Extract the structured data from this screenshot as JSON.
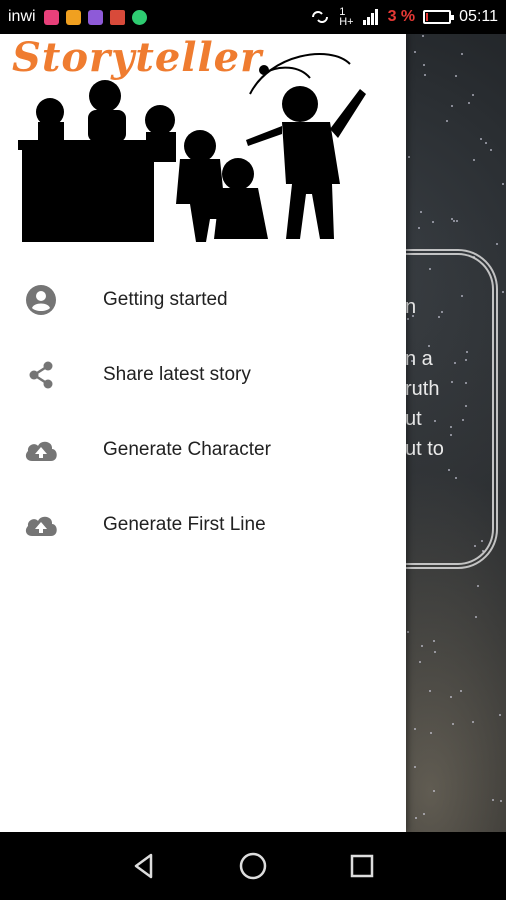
{
  "status_bar": {
    "carrier": "inwi",
    "network_label": "1",
    "network_type": "H+",
    "battery_percent": "3 %",
    "battery_level": 0.03,
    "time": "05:11",
    "notification_icons": [
      "store-icon",
      "lock-icon",
      "grid-icon",
      "mail-icon",
      "whatsapp-icon"
    ]
  },
  "drawer": {
    "brand": "Storyteller",
    "menu": [
      {
        "label": "Getting started",
        "icon": "account-circle-icon"
      },
      {
        "label": "Share latest story",
        "icon": "share-icon"
      },
      {
        "label": "Generate Character",
        "icon": "cloud-upload-icon"
      },
      {
        "label": "Generate First Line",
        "icon": "cloud-upload-icon"
      }
    ]
  },
  "background": {
    "text_fragments": [
      "n",
      "n a",
      "ruth",
      "ut",
      "ut to"
    ]
  },
  "colors": {
    "brand_orange": "#ef7c30",
    "icon_gray": "#757575",
    "battery_red": "#e53935"
  }
}
